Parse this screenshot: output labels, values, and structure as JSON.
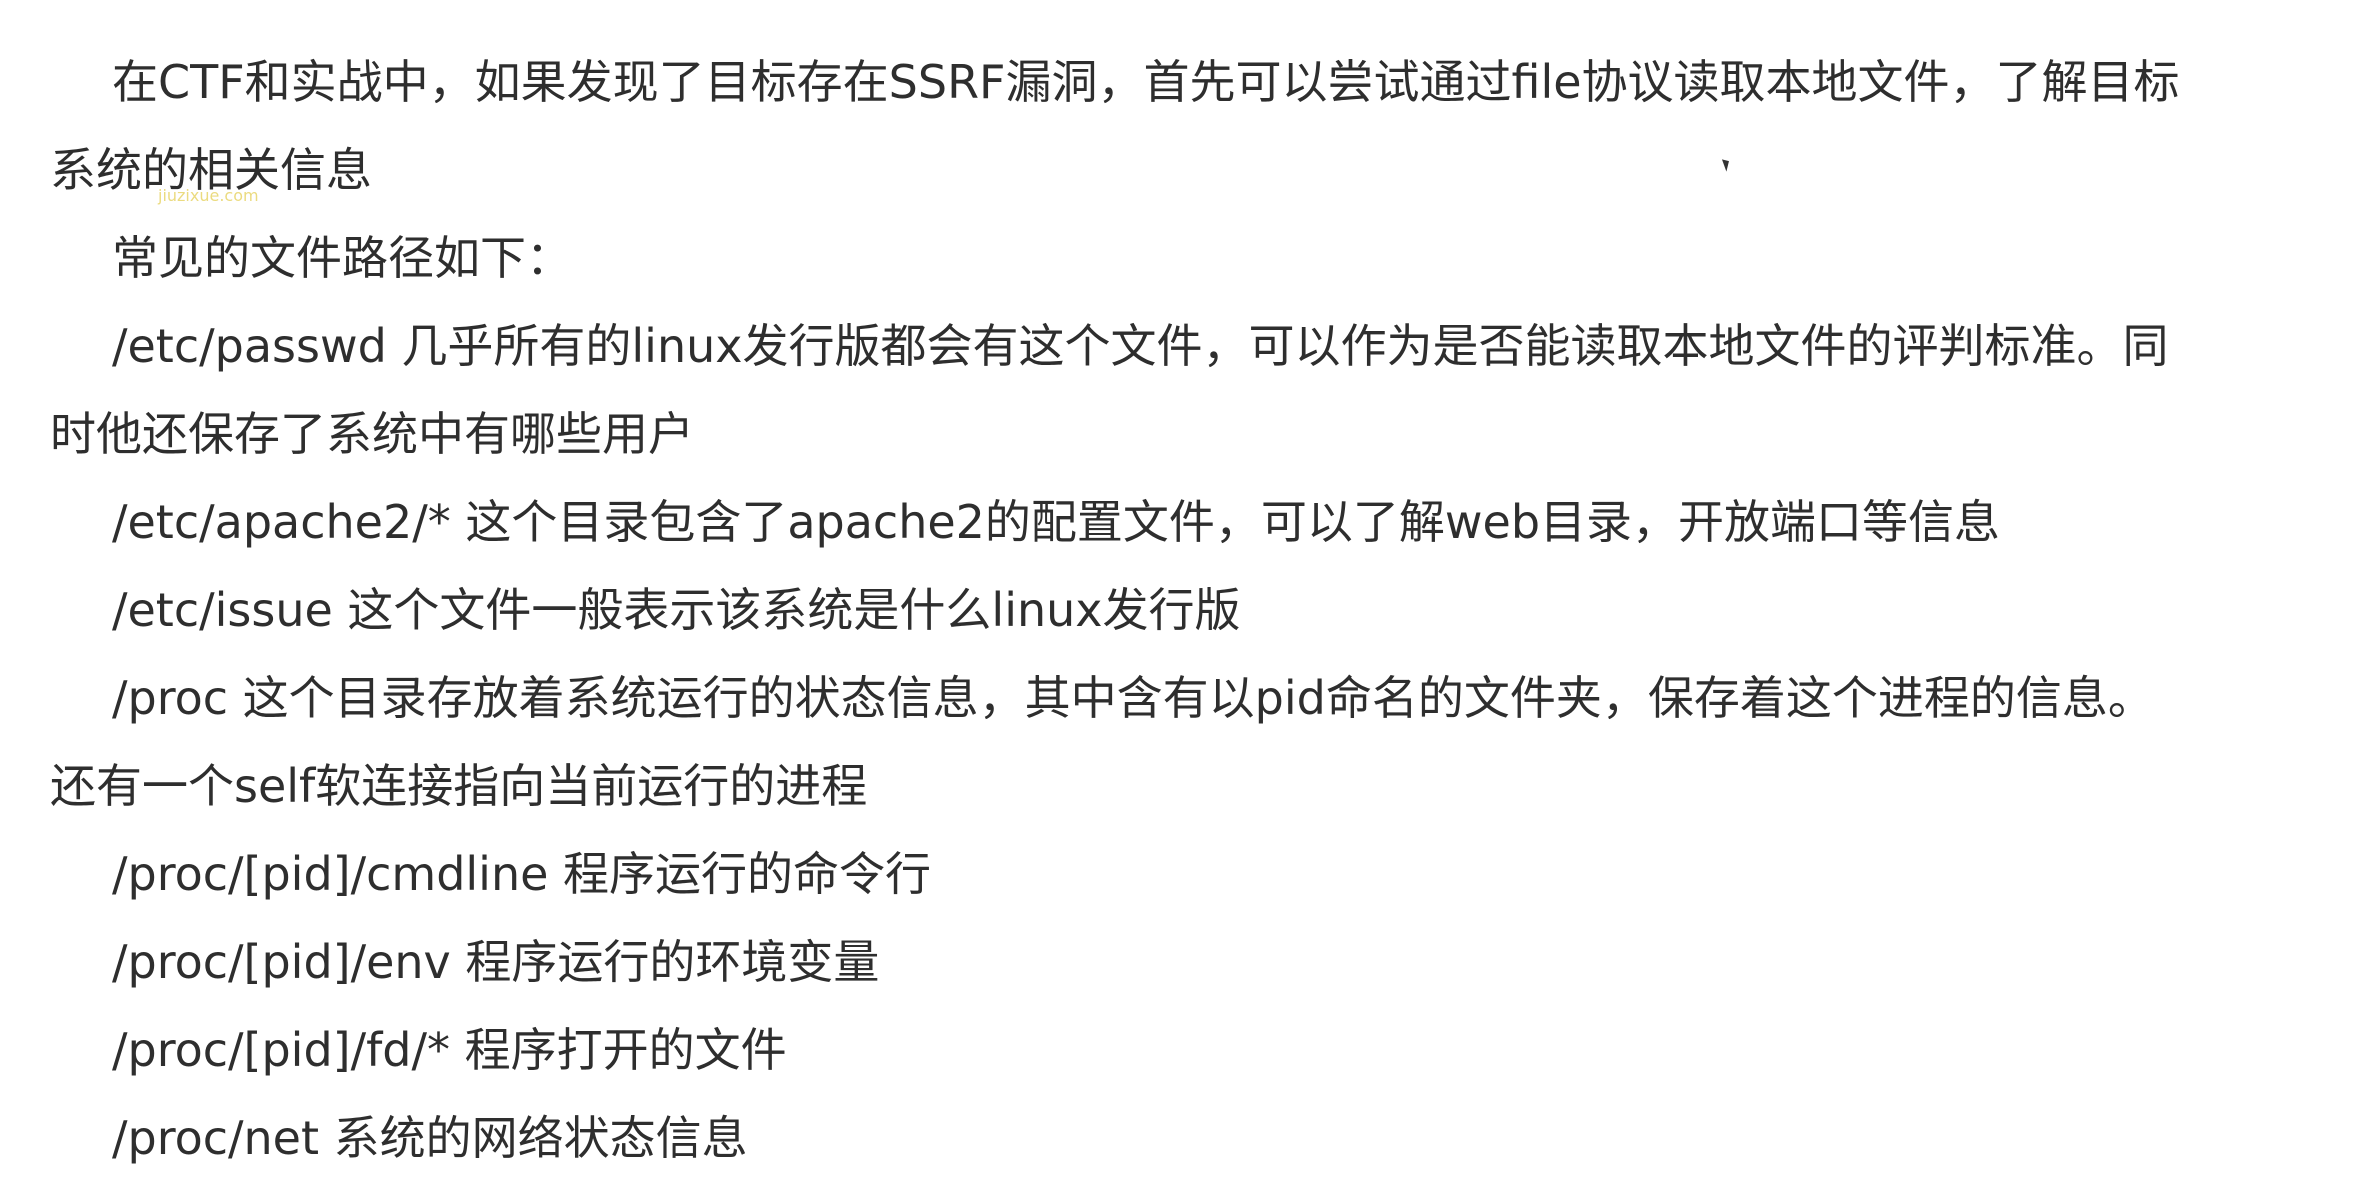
{
  "paragraphs": {
    "p1": {
      "line1": "在CTF和实战中，如果发现了目标存在SSRF漏洞，首先可以尝试通过file协议读取本地文件，了解目标",
      "line2": "系统的相关信息"
    },
    "p2": "常见的文件路径如下：",
    "p3": {
      "line1": "/etc/passwd  几乎所有的linux发行版都会有这个文件，可以作为是否能读取本地文件的评判标准。同",
      "line2": "时他还保存了系统中有哪些用户"
    },
    "p4": "/etc/apache2/* 这个目录包含了apache2的配置文件，可以了解web目录，开放端口等信息",
    "p5": "/etc/issue 这个文件一般表示该系统是什么linux发行版",
    "p6": {
      "line1": "/proc  这个目录存放着系统运行的状态信息，其中含有以pid命名的文件夹，保存着这个进程的信息。",
      "line2": "还有一个self软连接指向当前运行的进程"
    },
    "p7": "/proc/[pid]/cmdline 程序运行的命令行",
    "p8": "/proc/[pid]/env 程序运行的环境变量",
    "p9": "/proc/[pid]/fd/* 程序打开的文件",
    "p10": "/proc/net 系统的网络状态信息"
  },
  "watermark": "jiuzixue.com"
}
